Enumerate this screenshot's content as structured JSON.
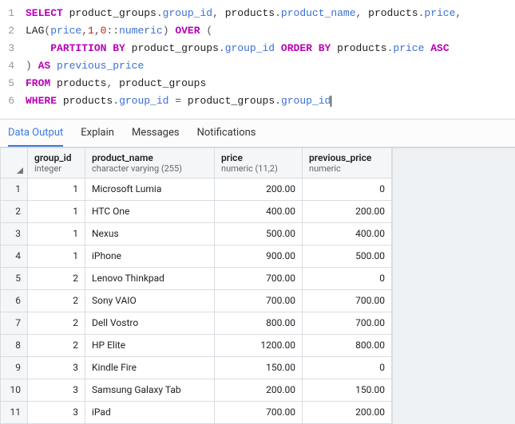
{
  "editor": {
    "lines": [
      {
        "num": "1",
        "tokens": [
          {
            "c": "kw",
            "t": "SELECT"
          },
          {
            "c": "",
            "t": " "
          },
          {
            "c": "ident",
            "t": "product_groups"
          },
          {
            "c": "punct",
            "t": "."
          },
          {
            "c": "col",
            "t": "group_id"
          },
          {
            "c": "punct",
            "t": ", "
          },
          {
            "c": "ident",
            "t": "products"
          },
          {
            "c": "punct",
            "t": "."
          },
          {
            "c": "col",
            "t": "product_name"
          },
          {
            "c": "punct",
            "t": ", "
          },
          {
            "c": "ident",
            "t": "products"
          },
          {
            "c": "punct",
            "t": "."
          },
          {
            "c": "col",
            "t": "price"
          },
          {
            "c": "punct",
            "t": ","
          }
        ]
      },
      {
        "num": "2",
        "tokens": [
          {
            "c": "func",
            "t": "LAG"
          },
          {
            "c": "punct",
            "t": "("
          },
          {
            "c": "col",
            "t": "price"
          },
          {
            "c": "punct",
            "t": ","
          },
          {
            "c": "num",
            "t": "1"
          },
          {
            "c": "punct",
            "t": ","
          },
          {
            "c": "num",
            "t": "0"
          },
          {
            "c": "punct",
            "t": "::"
          },
          {
            "c": "col",
            "t": "numeric"
          },
          {
            "c": "punct",
            "t": ") "
          },
          {
            "c": "kw",
            "t": "OVER"
          },
          {
            "c": "",
            "t": " "
          },
          {
            "c": "punct",
            "t": "("
          }
        ]
      },
      {
        "num": "3",
        "tokens": [
          {
            "c": "",
            "t": "    "
          },
          {
            "c": "kw",
            "t": "PARTITION BY"
          },
          {
            "c": "",
            "t": " "
          },
          {
            "c": "ident",
            "t": "product_groups"
          },
          {
            "c": "punct",
            "t": "."
          },
          {
            "c": "col",
            "t": "group_id"
          },
          {
            "c": "",
            "t": " "
          },
          {
            "c": "kw",
            "t": "ORDER BY"
          },
          {
            "c": "",
            "t": " "
          },
          {
            "c": "ident",
            "t": "products"
          },
          {
            "c": "punct",
            "t": "."
          },
          {
            "c": "col",
            "t": "price"
          },
          {
            "c": "",
            "t": " "
          },
          {
            "c": "kw",
            "t": "ASC"
          }
        ]
      },
      {
        "num": "4",
        "tokens": [
          {
            "c": "punct",
            "t": ") "
          },
          {
            "c": "kw",
            "t": "AS"
          },
          {
            "c": "",
            "t": " "
          },
          {
            "c": "col",
            "t": "previous_price"
          }
        ]
      },
      {
        "num": "5",
        "tokens": [
          {
            "c": "kw",
            "t": "FROM"
          },
          {
            "c": "",
            "t": " "
          },
          {
            "c": "ident",
            "t": "products"
          },
          {
            "c": "punct",
            "t": ", "
          },
          {
            "c": "ident",
            "t": "product_groups"
          }
        ]
      },
      {
        "num": "6",
        "tokens": [
          {
            "c": "kw",
            "t": "WHERE"
          },
          {
            "c": "",
            "t": " "
          },
          {
            "c": "ident",
            "t": "products"
          },
          {
            "c": "punct",
            "t": "."
          },
          {
            "c": "col",
            "t": "group_id"
          },
          {
            "c": "",
            "t": " "
          },
          {
            "c": "punct",
            "t": "="
          },
          {
            "c": "",
            "t": " "
          },
          {
            "c": "ident",
            "t": "product_groups"
          },
          {
            "c": "punct",
            "t": "."
          },
          {
            "c": "col",
            "t": "group_id"
          }
        ],
        "cursor": true
      }
    ]
  },
  "tabs": {
    "data_output": "Data Output",
    "explain": "Explain",
    "messages": "Messages",
    "notifications": "Notifications"
  },
  "columns": [
    {
      "name": "group_id",
      "type": "integer",
      "class": "col-group_id",
      "align": "num"
    },
    {
      "name": "product_name",
      "type": "character varying (255)",
      "class": "col-product_name",
      "align": "txt"
    },
    {
      "name": "price",
      "type": "numeric (11,2)",
      "class": "col-price",
      "align": "num"
    },
    {
      "name": "previous_price",
      "type": "numeric",
      "class": "col-previous_price",
      "align": "num"
    }
  ],
  "rows": [
    {
      "n": "1",
      "group_id": "1",
      "product_name": "Microsoft Lumia",
      "price": "200.00",
      "previous_price": "0"
    },
    {
      "n": "2",
      "group_id": "1",
      "product_name": "HTC One",
      "price": "400.00",
      "previous_price": "200.00"
    },
    {
      "n": "3",
      "group_id": "1",
      "product_name": "Nexus",
      "price": "500.00",
      "previous_price": "400.00"
    },
    {
      "n": "4",
      "group_id": "1",
      "product_name": "iPhone",
      "price": "900.00",
      "previous_price": "500.00"
    },
    {
      "n": "5",
      "group_id": "2",
      "product_name": "Lenovo Thinkpad",
      "price": "700.00",
      "previous_price": "0"
    },
    {
      "n": "6",
      "group_id": "2",
      "product_name": "Sony VAIO",
      "price": "700.00",
      "previous_price": "700.00"
    },
    {
      "n": "7",
      "group_id": "2",
      "product_name": "Dell Vostro",
      "price": "800.00",
      "previous_price": "700.00"
    },
    {
      "n": "8",
      "group_id": "2",
      "product_name": "HP Elite",
      "price": "1200.00",
      "previous_price": "800.00"
    },
    {
      "n": "9",
      "group_id": "3",
      "product_name": "Kindle Fire",
      "price": "150.00",
      "previous_price": "0"
    },
    {
      "n": "10",
      "group_id": "3",
      "product_name": "Samsung Galaxy Tab",
      "price": "200.00",
      "previous_price": "150.00"
    },
    {
      "n": "11",
      "group_id": "3",
      "product_name": "iPad",
      "price": "700.00",
      "previous_price": "200.00"
    }
  ]
}
